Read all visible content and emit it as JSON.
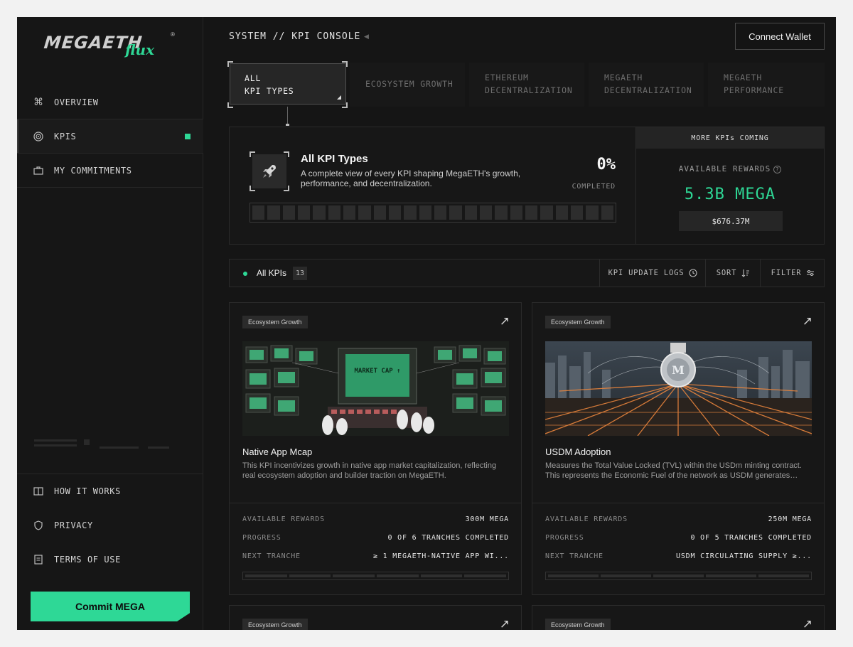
{
  "brand": {
    "logo_text": "MEGAETH",
    "logo_sub": "flux",
    "reg": "®"
  },
  "header": {
    "breadcrumb": "SYSTEM // KPI CONSOLE",
    "connect_label": "Connect Wallet"
  },
  "sidebar": {
    "items": [
      {
        "label": "OVERVIEW",
        "icon": "command-icon"
      },
      {
        "label": "KPIS",
        "icon": "target-icon",
        "active": true
      },
      {
        "label": "MY COMMITMENTS",
        "icon": "briefcase-icon"
      }
    ],
    "bottom_items": [
      {
        "label": "HOW IT WORKS",
        "icon": "book-icon"
      },
      {
        "label": "PRIVACY",
        "icon": "shield-icon"
      },
      {
        "label": "TERMS OF USE",
        "icon": "document-icon"
      }
    ],
    "commit_label": "Commit MEGA"
  },
  "tabs": [
    {
      "line1": "ALL",
      "line2": "KPI TYPES"
    },
    {
      "line1": "ECOSYSTEM GROWTH",
      "line2": ""
    },
    {
      "line1": "ETHEREUM",
      "line2": "DECENTRALIZATION"
    },
    {
      "line1": "MEGAETH",
      "line2": "DECENTRALIZATION"
    },
    {
      "line1": "MEGAETH",
      "line2": "PERFORMANCE"
    }
  ],
  "summary": {
    "title": "All KPI Types",
    "description": "A complete view of every KPI shaping MegaETH's growth, performance, and decentralization.",
    "percent": "0%",
    "percent_label": "COMPLETED",
    "progress": 0
  },
  "rewards": {
    "header": "MORE KPIs COMING",
    "label": "AVAILABLE REWARDS",
    "amount": "5.3B MEGA",
    "usd": "$676.37M"
  },
  "filterbar": {
    "label": "All KPIs",
    "count": "13",
    "update_logs": "KPI UPDATE LOGS",
    "sort": "SORT",
    "filter": "FILTER"
  },
  "cards": [
    {
      "tag": "Ecosystem Growth",
      "title": "Native App Mcap",
      "description": "This KPI incentivizes growth in native app market capitalization, reflecting real ecosystem adoption and builder traction on MegaETH.",
      "k1": "AVAILABLE REWARDS",
      "v1": "300M MEGA",
      "k2": "PROGRESS",
      "v2": "0 OF 6 TRANCHES COMPLETED",
      "k3": "NEXT TRANCHE",
      "v3": "≥ 1 MEGAETH-NATIVE APP WI...",
      "tranches": 6,
      "image_label": "MARKET CAP ↑"
    },
    {
      "tag": "Ecosystem Growth",
      "title": "USDM Adoption",
      "description": "Measures the Total Value Locked (TVL) within the USDm minting contract. This represents the Economic Fuel of the network as USDM generates…",
      "k1": "AVAILABLE REWARDS",
      "v1": "250M MEGA",
      "k2": "PROGRESS",
      "v2": "0 OF 5 TRANCHES COMPLETED",
      "k3": "NEXT TRANCHE",
      "v3": "USDM CIRCULATING SUPPLY ≥...",
      "tranches": 5
    }
  ],
  "partial_cards": [
    {
      "tag": "Ecosystem Growth"
    },
    {
      "tag": "Ecosystem Growth"
    }
  ]
}
